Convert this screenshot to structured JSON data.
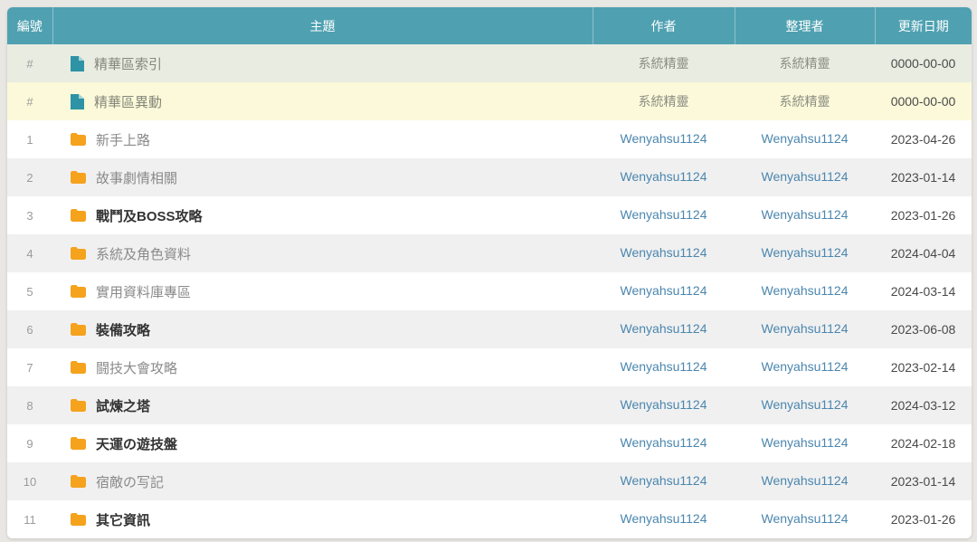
{
  "table": {
    "columns": [
      {
        "key": "number",
        "label": "編號"
      },
      {
        "key": "topic",
        "label": "主題"
      },
      {
        "key": "author",
        "label": "作者"
      },
      {
        "key": "editor",
        "label": "整理者"
      },
      {
        "key": "date",
        "label": "更新日期"
      }
    ],
    "special_rows": [
      {
        "num": "#",
        "topic": "精華區索引",
        "author": "系統精靈",
        "editor": "系統精靈",
        "date": "0000-00-00",
        "style": "green"
      },
      {
        "num": "#",
        "topic": "精華區異動",
        "author": "系統精靈",
        "editor": "系統精靈",
        "date": "0000-00-00",
        "style": "yellow"
      }
    ],
    "rows": [
      {
        "num": "1",
        "topic": "新手上路",
        "author": "Wenyahsu1124",
        "editor": "Wenyahsu1124",
        "date": "2023-04-26",
        "bold": false
      },
      {
        "num": "2",
        "topic": "故事劇情相關",
        "author": "Wenyahsu1124",
        "editor": "Wenyahsu1124",
        "date": "2023-01-14",
        "bold": false
      },
      {
        "num": "3",
        "topic": "戰鬥及BOSS攻略",
        "author": "Wenyahsu1124",
        "editor": "Wenyahsu1124",
        "date": "2023-01-26",
        "bold": true
      },
      {
        "num": "4",
        "topic": "系統及角色資料",
        "author": "Wenyahsu1124",
        "editor": "Wenyahsu1124",
        "date": "2024-04-04",
        "bold": false
      },
      {
        "num": "5",
        "topic": "實用資料庫專區",
        "author": "Wenyahsu1124",
        "editor": "Wenyahsu1124",
        "date": "2024-03-14",
        "bold": false
      },
      {
        "num": "6",
        "topic": "裝備攻略",
        "author": "Wenyahsu1124",
        "editor": "Wenyahsu1124",
        "date": "2023-06-08",
        "bold": true
      },
      {
        "num": "7",
        "topic": "闘技大會攻略",
        "author": "Wenyahsu1124",
        "editor": "Wenyahsu1124",
        "date": "2023-02-14",
        "bold": false
      },
      {
        "num": "8",
        "topic": "試煉之塔",
        "author": "Wenyahsu1124",
        "editor": "Wenyahsu1124",
        "date": "2024-03-12",
        "bold": true
      },
      {
        "num": "9",
        "topic": "天運の遊技盤",
        "author": "Wenyahsu1124",
        "editor": "Wenyahsu1124",
        "date": "2024-02-18",
        "bold": true
      },
      {
        "num": "10",
        "topic": "宿敵の写記",
        "author": "Wenyahsu1124",
        "editor": "Wenyahsu1124",
        "date": "2023-01-14",
        "bold": false
      },
      {
        "num": "11",
        "topic": "其它資訊",
        "author": "Wenyahsu1124",
        "editor": "Wenyahsu1124",
        "date": "2023-01-26",
        "bold": true
      }
    ],
    "icons": {
      "folder": "folder-icon",
      "document": "document-icon"
    },
    "colors": {
      "header_bg": "#4fa1b1",
      "page_bg": "#e9e7e4",
      "stripe_bg": "#f0f0f0",
      "special_green_bg": "#e9ece1",
      "special_yellow_bg": "#fbf9d9",
      "link": "#4a86ae",
      "topic_regular": "#8a8a8a",
      "topic_bold": "#333333",
      "topic_special": "#84887b",
      "folder_icon": "#f5a21d",
      "document_icon": "#2e93a4"
    }
  }
}
